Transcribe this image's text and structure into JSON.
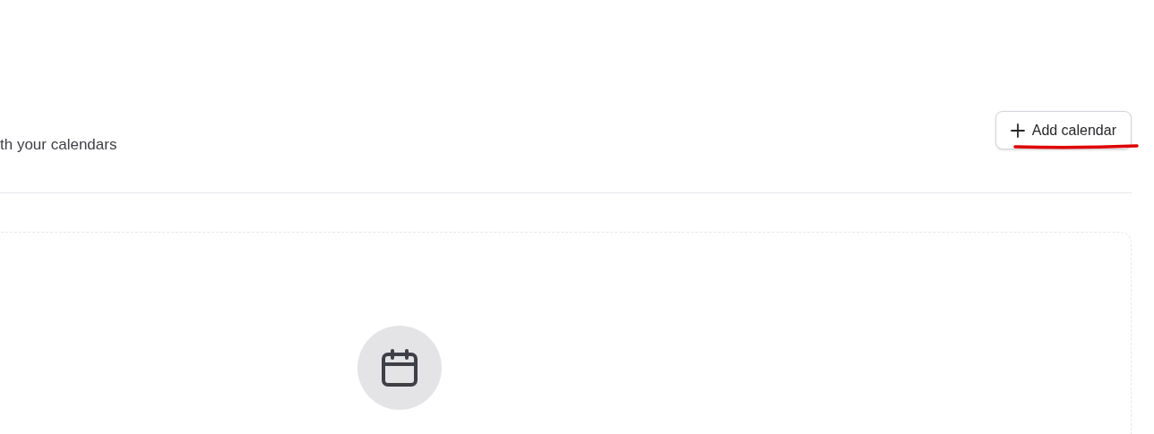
{
  "header": {
    "subtitle": "th your calendars",
    "add_button": {
      "label": "Add calendar",
      "underlined": true
    }
  },
  "empty_state": {
    "kind": "calendar"
  }
}
